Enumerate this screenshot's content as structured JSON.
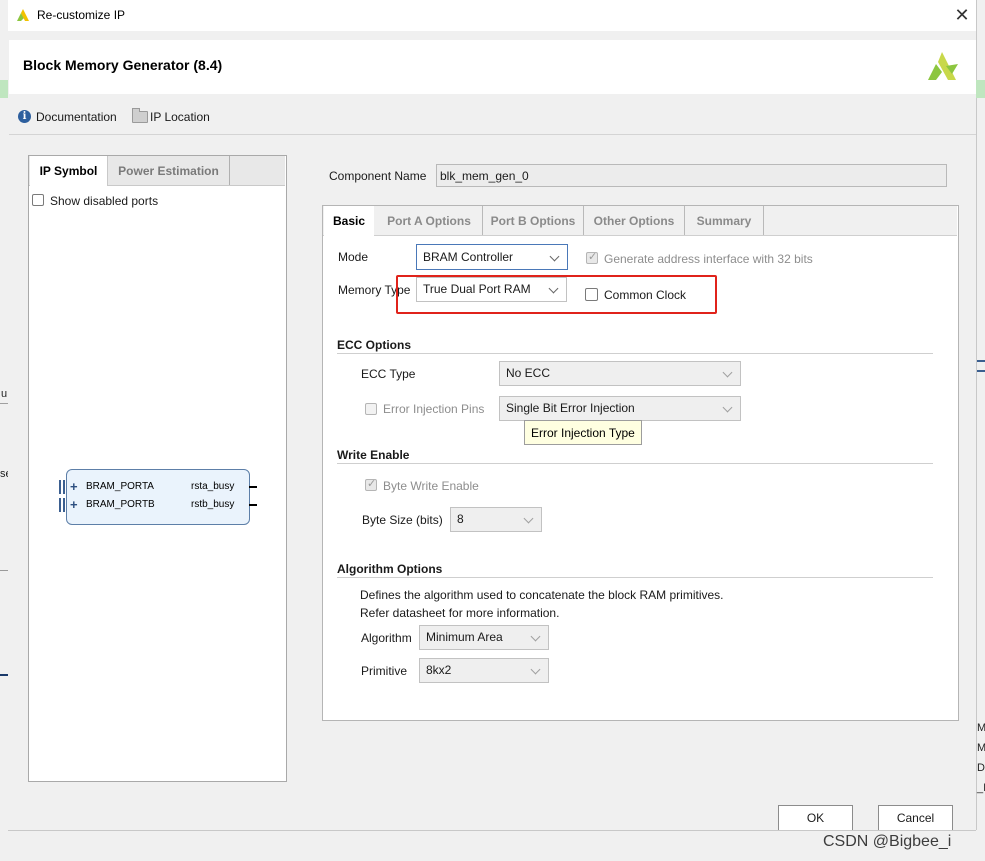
{
  "window": {
    "title": "Re-customize IP"
  },
  "header": {
    "ip_title": "Block Memory Generator (8.4)"
  },
  "toolbar": {
    "documentation": "Documentation",
    "ip_location": "IP Location"
  },
  "left_panel": {
    "tabs": [
      {
        "label": "IP Symbol"
      },
      {
        "label": "Power Estimation"
      }
    ],
    "show_disabled_ports": "Show disabled ports",
    "symbol": {
      "ports_left": [
        "BRAM_PORTA",
        "BRAM_PORTB"
      ],
      "ports_right": [
        "rsta_busy",
        "rstb_busy"
      ]
    }
  },
  "component": {
    "label": "Component Name",
    "value": "blk_mem_gen_0"
  },
  "tabs": [
    {
      "label": "Basic"
    },
    {
      "label": "Port A Options"
    },
    {
      "label": "Port B Options"
    },
    {
      "label": "Other Options"
    },
    {
      "label": "Summary"
    }
  ],
  "basic": {
    "mode_label": "Mode",
    "mode_value": "BRAM Controller",
    "gen_addr_label": "Generate address interface with 32 bits",
    "memory_type_label": "Memory Type",
    "memory_type_value": "True Dual Port RAM",
    "common_clock_label": "Common Clock",
    "ecc": {
      "title": "ECC Options",
      "type_label": "ECC Type",
      "type_value": "No ECC",
      "injection_label": "Error Injection Pins",
      "injection_value": "Single Bit Error Injection",
      "tooltip": "Error Injection Type"
    },
    "write_enable": {
      "title": "Write Enable",
      "byte_write_label": "Byte Write Enable",
      "byte_size_label": "Byte Size (bits)",
      "byte_size_value": "8"
    },
    "algorithm": {
      "title": "Algorithm Options",
      "desc1": "Defines the algorithm used to concatenate the block RAM primitives.",
      "desc2": "Refer datasheet for more information.",
      "algorithm_label": "Algorithm",
      "algorithm_value": "Minimum Area",
      "primitive_label": "Primitive",
      "primitive_value": "8kx2"
    }
  },
  "buttons": {
    "ok": "OK",
    "cancel": "Cancel"
  },
  "watermark": "CSDN @Bigbee_i",
  "background_fragments": {
    "left": [
      "u",
      "se"
    ],
    "right": [
      "M",
      "M",
      "D",
      "_I"
    ]
  },
  "colors": {
    "accent_blue": "#4a78b8",
    "highlight_red": "#e0231b",
    "tooltip_bg": "#ffffe1",
    "xilinx_green": "#8cc63f"
  },
  "icons": [
    "xilinx-logo-icon",
    "close-icon",
    "info-icon",
    "folder-icon",
    "chevron-down-icon"
  ]
}
